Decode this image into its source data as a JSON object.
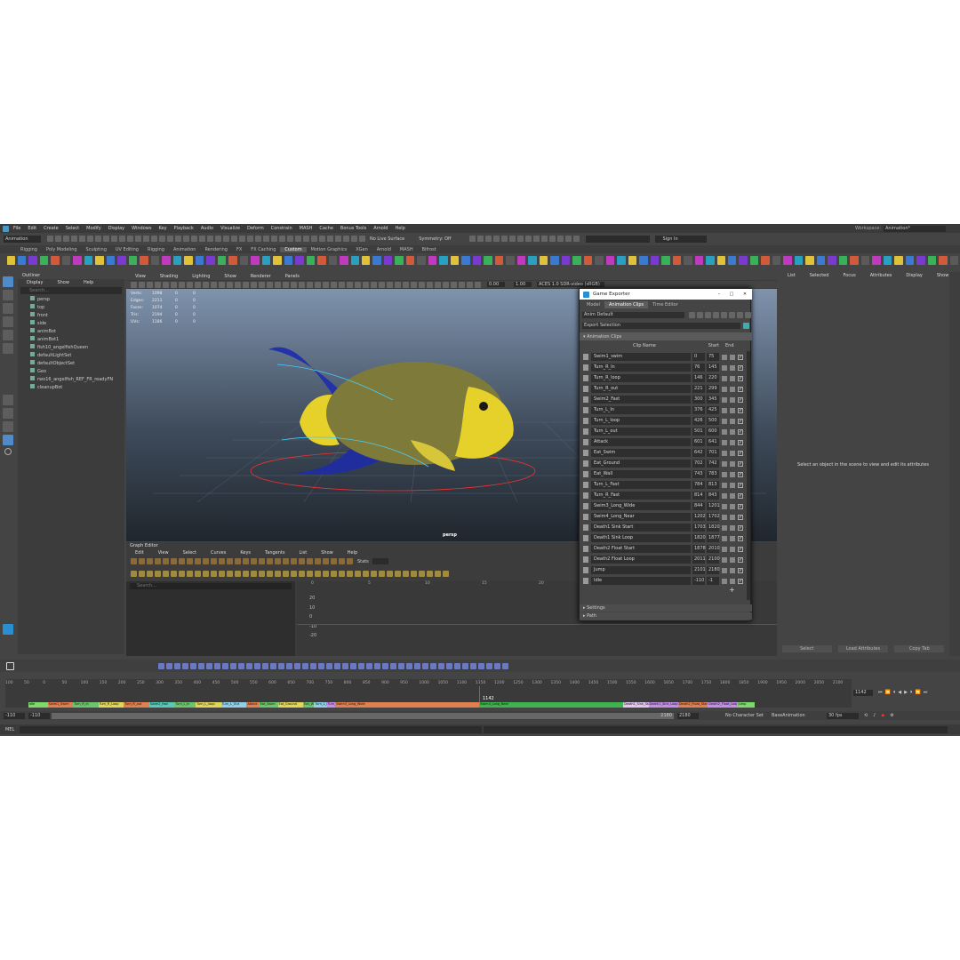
{
  "menubar": {
    "items": [
      "File",
      "Edit",
      "Create",
      "Select",
      "Modify",
      "Display",
      "Windows",
      "Key",
      "Playback",
      "Audio",
      "Visualize",
      "Deform",
      "Constrain",
      "MASH",
      "Cache",
      "Bonus Tools",
      "Arnold",
      "Help"
    ],
    "workspace_label": "Workspace:",
    "workspace_value": "Animation*"
  },
  "statusline": {
    "mode": "Animation",
    "no_live_surface": "No Live Surface",
    "symmetry": "Symmetry: Off",
    "sign_in": "Sign In"
  },
  "shelf": {
    "tabs": [
      "Rigging",
      "Poly Modeling",
      "Sculpting",
      "UV Editing",
      "Rigging",
      "Animation",
      "Rendering",
      "FX",
      "FX Caching",
      "Custom",
      "Motion Graphics",
      "XGen",
      "Arnold",
      "MASH",
      "Bifrost"
    ],
    "active_tab": "Custom"
  },
  "viewport": {
    "menus": [
      "View",
      "Shading",
      "Lighting",
      "Show",
      "Renderer",
      "Panels"
    ],
    "hud_labels": [
      "Verts:",
      "Edges:",
      "Faces:",
      "Tris:",
      "UVs:"
    ],
    "hud_values": [
      "1098",
      "2211",
      "1074",
      "2194",
      "1186"
    ],
    "hud_zero": "0",
    "field_a": "0.00",
    "field_b": "1.00",
    "color_space": "ACES 1.0 SDR-video (sRGB)",
    "camera": "persp"
  },
  "outliner": {
    "title": "Outliner",
    "menus": [
      "Display",
      "Show",
      "Help"
    ],
    "search_placeholder": "Search...",
    "items": [
      "persp",
      "top",
      "front",
      "side",
      "animBot",
      "animBot1",
      "fish10_angelfishQueen",
      "defaultLightSet",
      "defaultObjectSet",
      "Geo",
      "rwo16_angelfish_REF_FR_readyFN",
      "cleanupBot"
    ]
  },
  "game_exporter": {
    "title": "Game Exporter",
    "tabs": [
      "Model",
      "Animation Clips",
      "Time Editor"
    ],
    "active_tab": "Animation Clips",
    "preset": "Anim Default",
    "export_selection": "Export Selection",
    "section": "Animation Clips",
    "columns": [
      "Clip Name",
      "Start",
      "End"
    ],
    "clips": [
      {
        "name": "Swim1_swim",
        "start": "0",
        "end": "75"
      },
      {
        "name": "Turn_R_In",
        "start": "76",
        "end": "145"
      },
      {
        "name": "Turn_R_loop",
        "start": "146",
        "end": "220"
      },
      {
        "name": "Turn_R_out",
        "start": "221",
        "end": "299"
      },
      {
        "name": "Swim2_Fast",
        "start": "300",
        "end": "345"
      },
      {
        "name": "Turn_L_In",
        "start": "376",
        "end": "425"
      },
      {
        "name": "Turn_L_loop",
        "start": "426",
        "end": "500"
      },
      {
        "name": "Turn_L_out",
        "start": "501",
        "end": "600"
      },
      {
        "name": "Attack",
        "start": "601",
        "end": "641"
      },
      {
        "name": "Eat_Swim",
        "start": "642",
        "end": "701"
      },
      {
        "name": "Eat_Ground",
        "start": "702",
        "end": "742"
      },
      {
        "name": "Eat_Wall",
        "start": "743",
        "end": "783"
      },
      {
        "name": "Turn_L_Fast",
        "start": "784",
        "end": "813"
      },
      {
        "name": "Turn_R_Fast",
        "start": "814",
        "end": "843"
      },
      {
        "name": "Swim3_Long_Wide",
        "start": "844",
        "end": "1201"
      },
      {
        "name": "Swim4_Long_Near",
        "start": "1202",
        "end": "1702"
      },
      {
        "name": "Death1 Sink Start",
        "start": "1703",
        "end": "1820"
      },
      {
        "name": "Death1 Sink Loop",
        "start": "1820",
        "end": "1877"
      },
      {
        "name": "Death2 Float Start",
        "start": "1878",
        "end": "2010"
      },
      {
        "name": "Death2 Float Loop",
        "start": "2011",
        "end": "2100"
      },
      {
        "name": "Jump",
        "start": "2101",
        "end": "2180"
      },
      {
        "name": "Idle",
        "start": "-110",
        "end": "-1"
      }
    ],
    "settings_label": "Settings",
    "path_label": "Path"
  },
  "graph_editor": {
    "title": "Graph Editor",
    "menus": [
      "Edit",
      "View",
      "Select",
      "Curves",
      "Keys",
      "Tangents",
      "List",
      "Show",
      "Help"
    ],
    "stats_label": "Stats",
    "search_placeholder": "Search...",
    "x_ticks": [
      "0",
      "5",
      "10",
      "15",
      "20"
    ],
    "y_ticks": [
      "20",
      "10",
      "0",
      "-10",
      "-20"
    ]
  },
  "attribute_editor": {
    "menus": [
      "List",
      "Selected",
      "Focus",
      "Attributes",
      "Display",
      "Show",
      "Help"
    ],
    "message": "Select an object in the scene to view and edit its attributes",
    "buttons": [
      "Select",
      "Load Attributes",
      "Copy Tab"
    ]
  },
  "timeline": {
    "ticks": [
      "100",
      "50",
      "0",
      "50",
      "100",
      "150",
      "200",
      "250",
      "300",
      "350",
      "400",
      "450",
      "500",
      "550",
      "600",
      "650",
      "700",
      "750",
      "800",
      "850",
      "900",
      "950",
      "1000",
      "1050",
      "1100",
      "1150",
      "1200",
      "1250",
      "1300",
      "1350",
      "1400",
      "1450",
      "1500",
      "1550",
      "1600",
      "1650",
      "1700",
      "1750",
      "1800",
      "1850",
      "1900",
      "1950",
      "2000",
      "2050",
      "2100"
    ],
    "current_frame": "1142",
    "current_field": "1142",
    "segments": [
      {
        "label": "Idle",
        "color": "#7fd86c",
        "from": 0.027,
        "to": 0.05
      },
      {
        "label": "Swim1_Swim",
        "color": "#e07f4f",
        "from": 0.05,
        "to": 0.08
      },
      {
        "label": "Turn_R_In",
        "color": "#6cc46c",
        "from": 0.08,
        "to": 0.11
      },
      {
        "label": "Turn_R_Loop",
        "color": "#e0d65a",
        "from": 0.11,
        "to": 0.14
      },
      {
        "label": "Turn_R_out",
        "color": "#e07f4f",
        "from": 0.14,
        "to": 0.17
      },
      {
        "label": "Swim2_fast",
        "color": "#56c9b8",
        "from": 0.17,
        "to": 0.2
      },
      {
        "label": "Turn_L_In",
        "color": "#6cc46c",
        "from": 0.2,
        "to": 0.225
      },
      {
        "label": "Turn_L_loop",
        "color": "#e0d65a",
        "from": 0.225,
        "to": 0.255
      },
      {
        "label": "Turn_L_Out",
        "color": "#8fd0e8",
        "from": 0.255,
        "to": 0.285
      },
      {
        "label": "Attack",
        "color": "#e07f4f",
        "from": 0.285,
        "to": 0.3
      },
      {
        "label": "Eat_Swim",
        "color": "#6cc46c",
        "from": 0.3,
        "to": 0.322
      },
      {
        "label": "Eat_Ground",
        "color": "#e0d65a",
        "from": 0.322,
        "to": 0.352
      },
      {
        "label": "Eat_Wall",
        "color": "#6cc46c",
        "from": 0.352,
        "to": 0.365
      },
      {
        "label": "Turn_L_Fast",
        "color": "#8fd0e8",
        "from": 0.365,
        "to": 0.38
      },
      {
        "label": "Turn_R",
        "color": "#c48fe8",
        "from": 0.38,
        "to": 0.39
      },
      {
        "label": "Swim3_Long_Wide",
        "color": "#e07f4f",
        "from": 0.39,
        "to": 0.56
      },
      {
        "label": "Swim4_Long_Near",
        "color": "#3fb34f",
        "from": 0.56,
        "to": 0.73
      },
      {
        "label": "Death1_Sink_Start",
        "color": "#e2c8f0",
        "from": 0.73,
        "to": 0.76
      },
      {
        "label": "Death1_Sink_Loop",
        "color": "#c48fe8",
        "from": 0.76,
        "to": 0.795
      },
      {
        "label": "Death2_Float_Start",
        "color": "#e07f4f",
        "from": 0.795,
        "to": 0.83
      },
      {
        "label": "Death2_Float_Loop",
        "color": "#c48fe8",
        "from": 0.83,
        "to": 0.865
      },
      {
        "label": "Jump",
        "color": "#7fd86c",
        "from": 0.865,
        "to": 0.885
      }
    ]
  },
  "range": {
    "start": "-110",
    "start_inner": "-110",
    "end_inner": "2180",
    "end": "2180",
    "character_set": "No Character Set",
    "anim_layer": "BaseAnimation",
    "fps": "30 fps"
  },
  "command_line": {
    "label": "MEL"
  }
}
